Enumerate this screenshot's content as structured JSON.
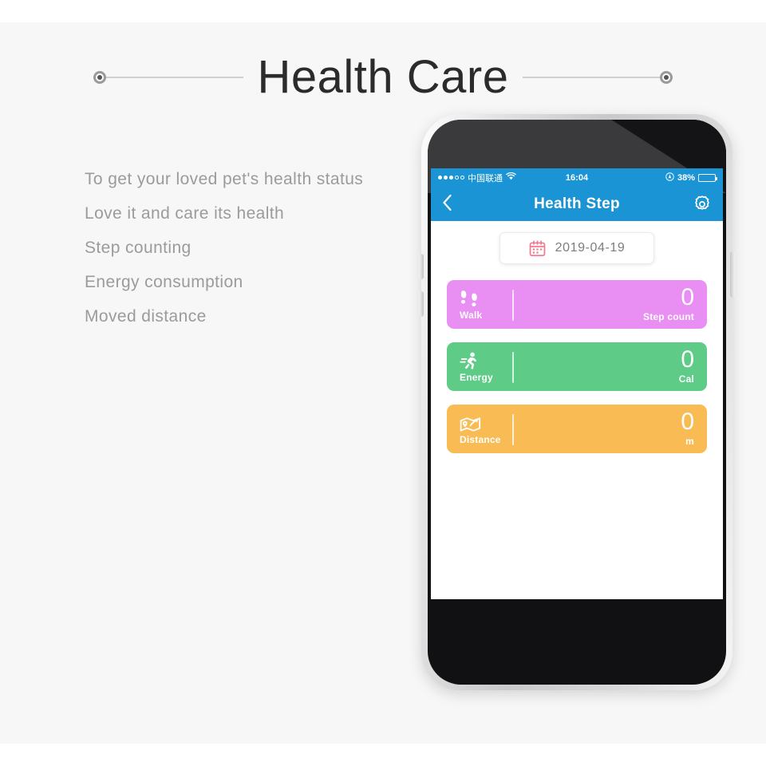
{
  "header": {
    "title": "Health Care"
  },
  "features": [
    "To get your loved pet's health status",
    "Love it and care its health",
    "Step counting",
    "Energy consumption",
    "Moved distance"
  ],
  "phone": {
    "status_bar": {
      "carrier": "中国联通",
      "time": "16:04",
      "battery_percent": "38%",
      "signal_filled": 3,
      "signal_empty": 2,
      "wifi_icon": "wifi-icon",
      "location_icon": "location-icon",
      "battery_icon": "battery-icon"
    },
    "nav_bar": {
      "back_icon": "chevron-left-icon",
      "title": "Health Step",
      "settings_icon": "gear-icon"
    },
    "date_picker": {
      "icon": "calendar-icon",
      "value": "2019-04-19"
    },
    "cards": [
      {
        "name": "walk",
        "icon": "footprints-icon",
        "label": "Walk",
        "value": "0",
        "unit": "Step count",
        "color": "#e98ef2"
      },
      {
        "name": "energy",
        "icon": "running-person-icon",
        "label": "Energy",
        "value": "0",
        "unit": "Cal",
        "color": "#5ecc87"
      },
      {
        "name": "distance",
        "icon": "map-route-icon",
        "label": "Distance",
        "value": "0",
        "unit": "m",
        "color": "#f9bc54"
      }
    ]
  },
  "colors": {
    "nav_blue": "#1b94d6",
    "page_background": "#f7f7f7",
    "title_text": "#2b2b2b",
    "feature_text": "#9b9b9b",
    "calendar_icon": "#f2788f"
  }
}
